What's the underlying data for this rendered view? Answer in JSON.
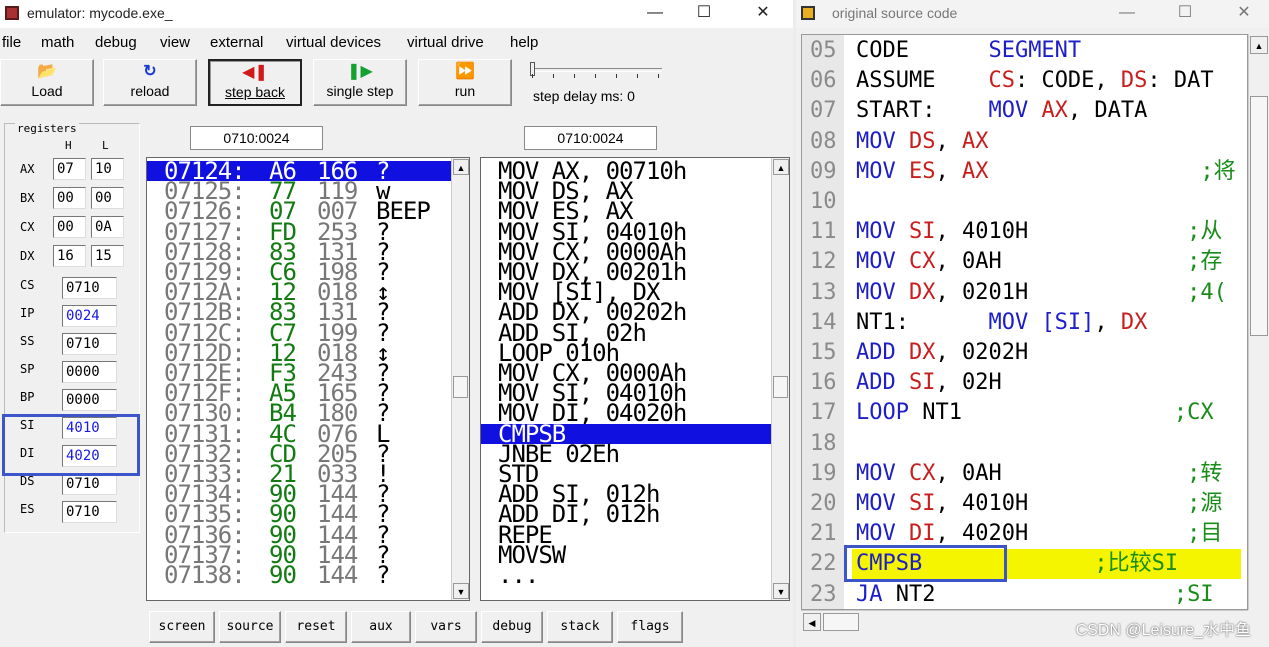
{
  "emulator": {
    "title": "emulator: mycode.exe_",
    "window_controls": {
      "minimize": "—",
      "maximize": "☐",
      "close": "✕"
    },
    "menu": [
      "file",
      "math",
      "debug",
      "view",
      "external",
      "virtual devices",
      "virtual drive",
      "help"
    ],
    "toolbar": {
      "load": "Load",
      "reload": "reload",
      "step_back": "step back",
      "single_step": "single step",
      "run": "run",
      "step_delay_label": "step delay ms: 0"
    },
    "registers": {
      "group_label": "registers",
      "col_h": "H",
      "col_l": "L",
      "split": [
        {
          "name": "AX",
          "h": "07",
          "l": "10"
        },
        {
          "name": "BX",
          "h": "00",
          "l": "00"
        },
        {
          "name": "CX",
          "h": "00",
          "l": "0A"
        },
        {
          "name": "DX",
          "h": "16",
          "l": "15"
        }
      ],
      "full": [
        {
          "name": "CS",
          "value": "0710",
          "blue": false
        },
        {
          "name": "IP",
          "value": "0024",
          "blue": true
        },
        {
          "name": "SS",
          "value": "0710",
          "blue": false
        },
        {
          "name": "SP",
          "value": "0000",
          "blue": false
        },
        {
          "name": "BP",
          "value": "0000",
          "blue": false
        },
        {
          "name": "SI",
          "value": "4010",
          "blue": true
        },
        {
          "name": "DI",
          "value": "4020",
          "blue": true
        },
        {
          "name": "DS",
          "value": "0710",
          "blue": false
        },
        {
          "name": "ES",
          "value": "0710",
          "blue": false
        }
      ]
    },
    "memory_address": "0710:0024",
    "disasm_address": "0710:0024",
    "memory_rows": [
      {
        "addr": "07124:",
        "hex": "A6",
        "dec": "166",
        "chr": "?",
        "selected": true
      },
      {
        "addr": "07125:",
        "hex": "77",
        "dec": "119",
        "chr": "w",
        "selected": false
      },
      {
        "addr": "07126:",
        "hex": "07",
        "dec": "007",
        "chr": "BEEP",
        "selected": false
      },
      {
        "addr": "07127:",
        "hex": "FD",
        "dec": "253",
        "chr": "?",
        "selected": false
      },
      {
        "addr": "07128:",
        "hex": "83",
        "dec": "131",
        "chr": "?",
        "selected": false
      },
      {
        "addr": "07129:",
        "hex": "C6",
        "dec": "198",
        "chr": "?",
        "selected": false
      },
      {
        "addr": "0712A:",
        "hex": "12",
        "dec": "018",
        "chr": "↕",
        "selected": false
      },
      {
        "addr": "0712B:",
        "hex": "83",
        "dec": "131",
        "chr": "?",
        "selected": false
      },
      {
        "addr": "0712C:",
        "hex": "C7",
        "dec": "199",
        "chr": "?",
        "selected": false
      },
      {
        "addr": "0712D:",
        "hex": "12",
        "dec": "018",
        "chr": "↕",
        "selected": false
      },
      {
        "addr": "0712E:",
        "hex": "F3",
        "dec": "243",
        "chr": "?",
        "selected": false
      },
      {
        "addr": "0712F:",
        "hex": "A5",
        "dec": "165",
        "chr": "?",
        "selected": false
      },
      {
        "addr": "07130:",
        "hex": "B4",
        "dec": "180",
        "chr": "?",
        "selected": false
      },
      {
        "addr": "07131:",
        "hex": "4C",
        "dec": "076",
        "chr": "L",
        "selected": false
      },
      {
        "addr": "07132:",
        "hex": "CD",
        "dec": "205",
        "chr": "?",
        "selected": false
      },
      {
        "addr": "07133:",
        "hex": "21",
        "dec": "033",
        "chr": "!",
        "selected": false
      },
      {
        "addr": "07134:",
        "hex": "90",
        "dec": "144",
        "chr": "?",
        "selected": false
      },
      {
        "addr": "07135:",
        "hex": "90",
        "dec": "144",
        "chr": "?",
        "selected": false
      },
      {
        "addr": "07136:",
        "hex": "90",
        "dec": "144",
        "chr": "?",
        "selected": false
      },
      {
        "addr": "07137:",
        "hex": "90",
        "dec": "144",
        "chr": "?",
        "selected": false
      },
      {
        "addr": "07138:",
        "hex": "90",
        "dec": "144",
        "chr": "?",
        "selected": false
      }
    ],
    "disasm_rows": [
      {
        "text": "MOV AX, 00710h",
        "selected": false
      },
      {
        "text": "MOV DS, AX",
        "selected": false
      },
      {
        "text": "MOV ES, AX",
        "selected": false
      },
      {
        "text": "MOV SI, 04010h",
        "selected": false
      },
      {
        "text": "MOV CX, 0000Ah",
        "selected": false
      },
      {
        "text": "MOV DX, 00201h",
        "selected": false
      },
      {
        "text": "MOV [SI], DX",
        "selected": false
      },
      {
        "text": "ADD DX, 00202h",
        "selected": false
      },
      {
        "text": "ADD SI, 02h",
        "selected": false
      },
      {
        "text": "LOOP 010h",
        "selected": false
      },
      {
        "text": "MOV CX, 0000Ah",
        "selected": false
      },
      {
        "text": "MOV SI, 04010h",
        "selected": false
      },
      {
        "text": "MOV DI, 04020h",
        "selected": false
      },
      {
        "text": "CMPSB",
        "selected": true
      },
      {
        "text": "JNBE 02Eh",
        "selected": false
      },
      {
        "text": "STD",
        "selected": false
      },
      {
        "text": "ADD SI, 012h",
        "selected": false
      },
      {
        "text": "ADD DI, 012h",
        "selected": false
      },
      {
        "text": "REPE",
        "selected": false
      },
      {
        "text": "MOVSW",
        "selected": false
      },
      {
        "text": "...",
        "selected": false
      }
    ],
    "bottom_buttons": [
      "screen",
      "source",
      "reset",
      "aux",
      "vars",
      "debug",
      "stack",
      "flags"
    ]
  },
  "source": {
    "title": "original source code",
    "window_controls": {
      "minimize": "—",
      "maximize": "☐",
      "close": "✕"
    },
    "lines": [
      {
        "num": "05",
        "parts": [
          {
            "t": "CODE      ",
            "c": "nt"
          },
          {
            "t": "SEGMENT",
            "c": "kw"
          }
        ]
      },
      {
        "num": "06",
        "parts": [
          {
            "t": "ASSUME    ",
            "c": "nt"
          },
          {
            "t": "CS",
            "c": "rg"
          },
          {
            "t": ": CODE, ",
            "c": "nt"
          },
          {
            "t": "DS",
            "c": "rg"
          },
          {
            "t": ": DAT",
            "c": "nt"
          }
        ]
      },
      {
        "num": "07",
        "parts": [
          {
            "t": "START:    ",
            "c": "nt"
          },
          {
            "t": "MOV ",
            "c": "kw"
          },
          {
            "t": "AX",
            "c": "rg"
          },
          {
            "t": ", DATA",
            "c": "nt"
          }
        ]
      },
      {
        "num": "08",
        "parts": [
          {
            "t": "MOV ",
            "c": "kw"
          },
          {
            "t": "DS",
            "c": "rg"
          },
          {
            "t": ", ",
            "c": "nt"
          },
          {
            "t": "AX",
            "c": "rg"
          }
        ]
      },
      {
        "num": "09",
        "parts": [
          {
            "t": "MOV ",
            "c": "kw"
          },
          {
            "t": "ES",
            "c": "rg"
          },
          {
            "t": ", ",
            "c": "nt"
          },
          {
            "t": "AX",
            "c": "rg"
          },
          {
            "t": "                ;将",
            "c": "cm"
          }
        ]
      },
      {
        "num": "10",
        "parts": []
      },
      {
        "num": "11",
        "parts": [
          {
            "t": "MOV ",
            "c": "kw"
          },
          {
            "t": "SI",
            "c": "rg"
          },
          {
            "t": ", 4010H",
            "c": "nt"
          },
          {
            "t": "            ;从",
            "c": "cm"
          }
        ]
      },
      {
        "num": "12",
        "parts": [
          {
            "t": "MOV ",
            "c": "kw"
          },
          {
            "t": "CX",
            "c": "rg"
          },
          {
            "t": ", 0AH",
            "c": "nt"
          },
          {
            "t": "              ;存",
            "c": "cm"
          }
        ]
      },
      {
        "num": "13",
        "parts": [
          {
            "t": "MOV ",
            "c": "kw"
          },
          {
            "t": "DX",
            "c": "rg"
          },
          {
            "t": ", 0201H",
            "c": "nt"
          },
          {
            "t": "            ;4(",
            "c": "cm"
          }
        ]
      },
      {
        "num": "14",
        "parts": [
          {
            "t": "NT1:      ",
            "c": "nt"
          },
          {
            "t": "MOV ",
            "c": "kw"
          },
          {
            "t": "[SI]",
            "c": "kw"
          },
          {
            "t": ", ",
            "c": "nt"
          },
          {
            "t": "DX",
            "c": "rg"
          }
        ]
      },
      {
        "num": "15",
        "parts": [
          {
            "t": "ADD ",
            "c": "kw"
          },
          {
            "t": "DX",
            "c": "rg"
          },
          {
            "t": ", 0202H",
            "c": "nt"
          }
        ]
      },
      {
        "num": "16",
        "parts": [
          {
            "t": "ADD ",
            "c": "kw"
          },
          {
            "t": "SI",
            "c": "rg"
          },
          {
            "t": ", 02H",
            "c": "nt"
          }
        ]
      },
      {
        "num": "17",
        "parts": [
          {
            "t": "LOOP ",
            "c": "kw"
          },
          {
            "t": "NT1",
            "c": "nt"
          },
          {
            "t": "                ;CX",
            "c": "cm"
          }
        ]
      },
      {
        "num": "18",
        "parts": []
      },
      {
        "num": "19",
        "parts": [
          {
            "t": "MOV ",
            "c": "kw"
          },
          {
            "t": "CX",
            "c": "rg"
          },
          {
            "t": ", 0AH",
            "c": "nt"
          },
          {
            "t": "              ;转",
            "c": "cm"
          }
        ]
      },
      {
        "num": "20",
        "parts": [
          {
            "t": "MOV ",
            "c": "kw"
          },
          {
            "t": "SI",
            "c": "rg"
          },
          {
            "t": ", 4010H",
            "c": "nt"
          },
          {
            "t": "            ;源",
            "c": "cm"
          }
        ]
      },
      {
        "num": "21",
        "parts": [
          {
            "t": "MOV ",
            "c": "kw"
          },
          {
            "t": "DI",
            "c": "rg"
          },
          {
            "t": ", 4020H",
            "c": "nt"
          },
          {
            "t": "            ;目",
            "c": "cm"
          }
        ]
      },
      {
        "num": "22",
        "parts": [
          {
            "t": "CMPSB",
            "c": "kw"
          },
          {
            "t": "             ;比较SI",
            "c": "cm"
          }
        ],
        "highlight": true
      },
      {
        "num": "23",
        "parts": [
          {
            "t": "JA ",
            "c": "kw"
          },
          {
            "t": "NT2",
            "c": "nt"
          },
          {
            "t": "                  ;SI",
            "c": "cm"
          }
        ]
      }
    ],
    "watermark": "CSDN @Leisure_水中鱼"
  },
  "colors": {
    "selection_blue": "#1010e0",
    "highlight_yellow": "#f5f500",
    "annotation_box": "#3c55c8",
    "keyword_blue": "#1e1ec8",
    "register_red": "#c81e1e",
    "comment_green": "#1a8c1a",
    "hex_green": "#117b11"
  }
}
